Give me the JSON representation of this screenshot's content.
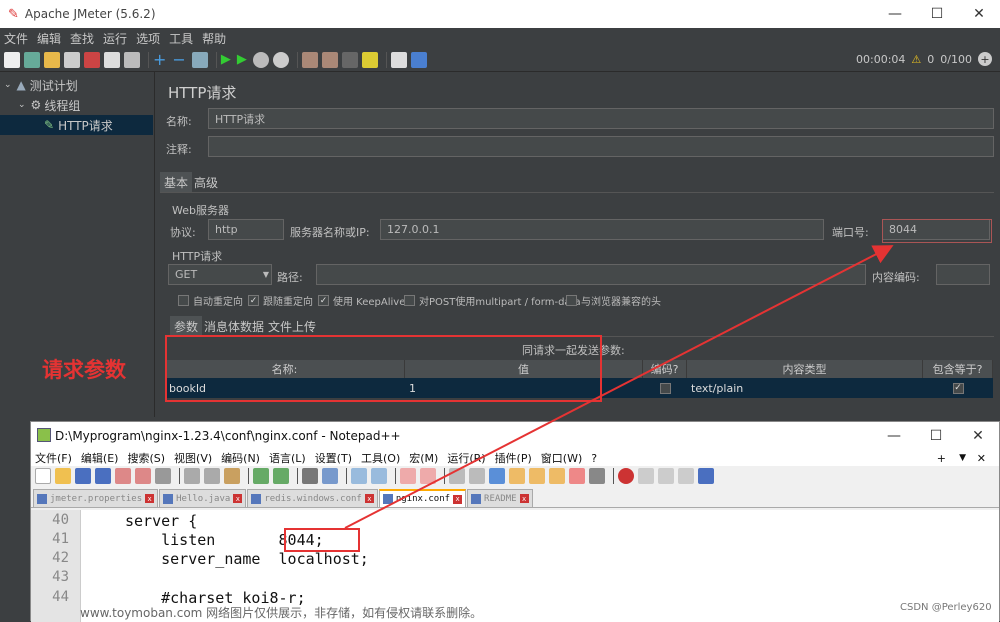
{
  "jmeter": {
    "title": "Apache JMeter (5.6.2)",
    "menu": [
      "文件",
      "编辑",
      "查找",
      "运行",
      "选项",
      "工具",
      "帮助"
    ],
    "status": {
      "timer": "00:00:04",
      "warn_count": "0",
      "threads": "0/100"
    },
    "tree": {
      "root": "测试计划",
      "group": "线程组",
      "sampler": "HTTP请求"
    },
    "panel": {
      "title": "HTTP请求",
      "name_label": "名称:",
      "name_value": "HTTP请求",
      "comment_label": "注释:",
      "tabs": [
        "基本",
        "高级"
      ],
      "web_server_label": "Web服务器",
      "protocol_label": "协议:",
      "protocol_value": "http",
      "server_label": "服务器名称或IP:",
      "server_value": "127.0.0.1",
      "port_label": "端口号:",
      "port_value": "8044",
      "http_request_label": "HTTP请求",
      "method_value": "GET",
      "path_label": "路径:",
      "encoding_label": "内容编码:",
      "checkboxes": [
        {
          "label": "自动重定向",
          "checked": false
        },
        {
          "label": "跟随重定向",
          "checked": true
        },
        {
          "label": "使用 KeepAlive",
          "checked": true
        },
        {
          "label": "对POST使用multipart / form-data",
          "checked": false
        },
        {
          "label": "与浏览器兼容的头",
          "checked": false
        }
      ],
      "subtabs": [
        "参数",
        "消息体数据",
        "文件上传"
      ],
      "params_caption": "同请求一起发送参数:",
      "columns": [
        "名称:",
        "值",
        "编码?",
        "内容类型",
        "包含等于?"
      ],
      "rows": [
        {
          "name": "bookId",
          "value": "1",
          "content_type": "text/plain",
          "include_equals": "✓"
        }
      ]
    }
  },
  "annotation": {
    "label": "请求参数",
    "color": "#e53333"
  },
  "notepad": {
    "title": "D:\\Myprogram\\nginx-1.23.4\\conf\\nginx.conf - Notepad++",
    "menu": [
      "文件(F)",
      "编辑(E)",
      "搜索(S)",
      "视图(V)",
      "编码(N)",
      "语言(L)",
      "设置(T)",
      "工具(O)",
      "宏(M)",
      "运行(R)",
      "插件(P)",
      "窗口(W)",
      "?"
    ],
    "tabs": [
      "jmeter.properties",
      "Hello.java",
      "redis.windows.conf",
      "nginx.conf",
      "README"
    ],
    "active_tab": "nginx.conf",
    "lines": [
      {
        "n": "40",
        "text": "server {"
      },
      {
        "n": "41",
        "text": "    listen       8044;"
      },
      {
        "n": "42",
        "text": "    server_name  localhost;"
      },
      {
        "n": "43",
        "text": ""
      },
      {
        "n": "44",
        "text": "    #charset koi8-r;"
      }
    ]
  },
  "watermark": "www.toymoban.com 网络图片仅供展示，非存储，如有侵权请联系删除。",
  "credit": "CSDN @Perley620"
}
